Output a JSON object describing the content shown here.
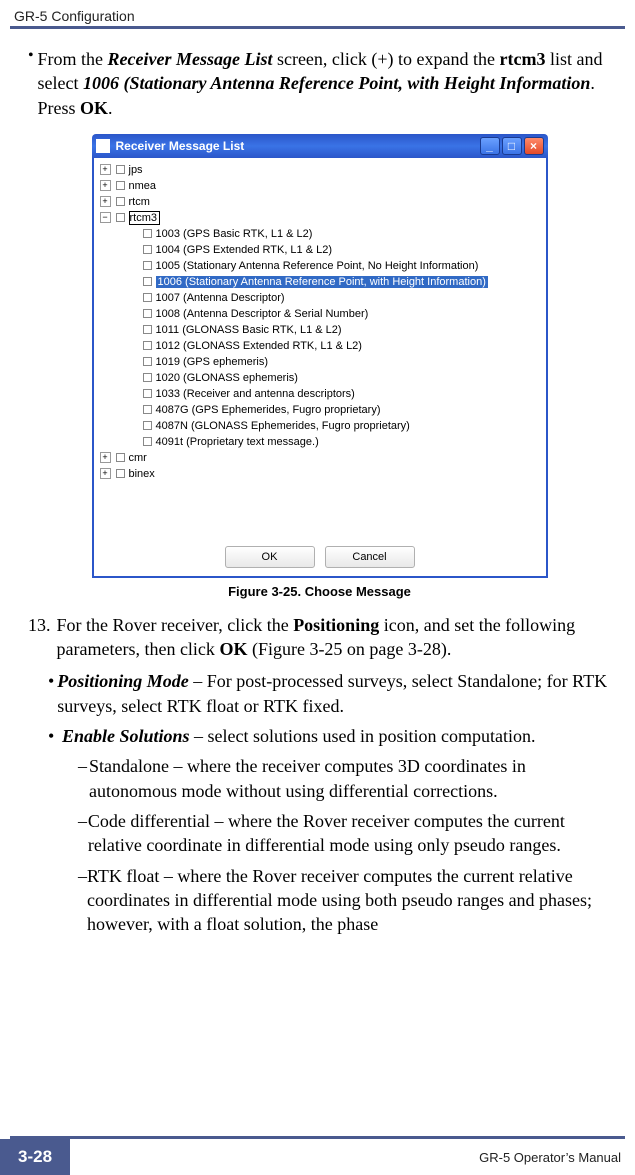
{
  "header": {
    "title": "GR-5 Configuration"
  },
  "bullet1": {
    "t1": "From the ",
    "t2": "Receiver Message List",
    "t3": " screen, click (+) to expand the ",
    "t4": "rtcm3",
    "t5": " list and select ",
    "t6": "1006 (Stationary Antenna Reference Point, with Height Information",
    "t7": ". Press ",
    "t8": "OK",
    "t9": "."
  },
  "window": {
    "title": "Receiver Message List",
    "topNodes": [
      {
        "toggle": "+",
        "label": "jps"
      },
      {
        "toggle": "+",
        "label": "nmea"
      },
      {
        "toggle": "+",
        "label": "rtcm"
      },
      {
        "toggle": "−",
        "label": "rtcm3",
        "boxed": true
      }
    ],
    "children": [
      "1003 (GPS Basic RTK, L1 & L2)",
      "1004 (GPS Extended RTK, L1 & L2)",
      "1005 (Stationary Antenna Reference Point, No Height Information)",
      "1006 (Stationary Antenna Reference Point, with Height Information)",
      "1007 (Antenna Descriptor)",
      "1008 (Antenna Descriptor & Serial Number)",
      "1011 (GLONASS Basic RTK, L1 & L2)",
      "1012 (GLONASS Extended RTK, L1 & L2)",
      "1019 (GPS ephemeris)",
      "1020 (GLONASS ephemeris)",
      "1033 (Receiver and antenna descriptors)",
      "4087G (GPS Ephemerides, Fugro proprietary)",
      "4087N (GLONASS Ephemerides, Fugro proprietary)",
      "4091t (Proprietary text message.)"
    ],
    "selectedChildIndex": 3,
    "bottomNodes": [
      {
        "toggle": "+",
        "label": "cmr"
      },
      {
        "toggle": "+",
        "label": "binex"
      }
    ],
    "buttons": {
      "ok": "OK",
      "cancel": "Cancel"
    }
  },
  "figureCaption": "Figure 3-25. Choose Message",
  "step13": {
    "num": "13.",
    "t1": "For the Rover receiver, click the ",
    "t2": "Positioning",
    "t3": " icon, and set the following parameters, then click ",
    "t4": "OK",
    "t5": " (Figure 3-25 on page 3-28)."
  },
  "sub1": {
    "name": "Positioning Mode",
    "text": " – For post-processed surveys, select Standalone; for RTK surveys, select RTK float or RTK fixed."
  },
  "sub2": {
    "name": "Enable Solutions",
    "text": " – select solutions used in position computation."
  },
  "dash1": "Standalone – where the receiver computes 3D coordinates in autonomous mode without using differential corrections.",
  "dash2": "Code differential – where the Rover receiver computes the current relative coordinate in differential mode using only pseudo ranges.",
  "dash3": "RTK float – where the Rover receiver computes the current relative coordinates in differential mode using both pseudo ranges and phases; however, with a float solution, the phase",
  "footer": {
    "page": "3-28",
    "manual": "GR-5 Operator’s Manual"
  }
}
